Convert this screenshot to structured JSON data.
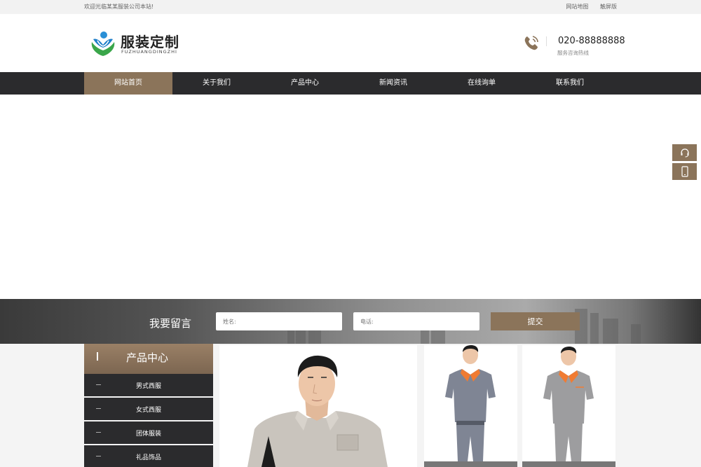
{
  "topbar": {
    "welcome": "欢迎光临某某服装公司本站!",
    "links": [
      "网站地图",
      "触屏版"
    ]
  },
  "header": {
    "logo_title": "服装定制",
    "logo_sub": "FUZHUANGDINGZHI",
    "phone": "020-88888888",
    "phone_label": "服务咨询热线"
  },
  "nav": {
    "items": [
      "网站首页",
      "关于我们",
      "产品中心",
      "新闻资讯",
      "在线询单",
      "联系我们"
    ],
    "active_index": 0
  },
  "side_buttons": [
    "headset-icon",
    "mobile-icon"
  ],
  "message": {
    "title": "我要留言",
    "name_placeholder": "姓名:",
    "phone_placeholder": "电话:",
    "submit_label": "提交"
  },
  "categories": {
    "title": "产品中心",
    "items": [
      "男式西服",
      "女式西服",
      "团体服装",
      "礼品饰品"
    ]
  },
  "colors": {
    "accent": "#8b745a",
    "nav_bg": "#2b2b2d",
    "topbar_bg": "#f2f2f2"
  }
}
